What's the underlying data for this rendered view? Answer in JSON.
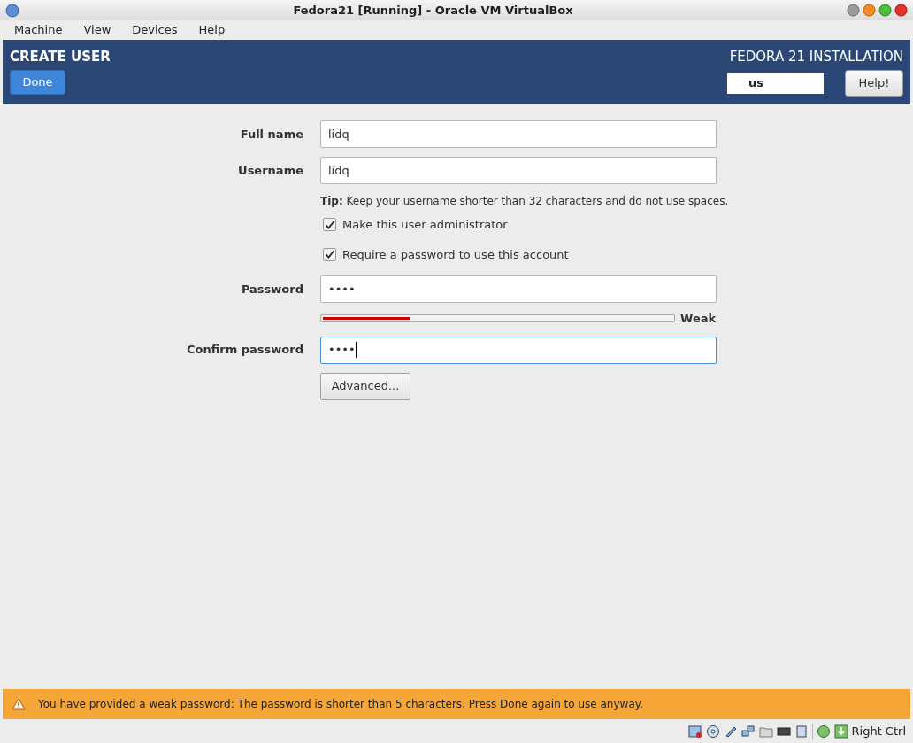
{
  "window": {
    "title": "Fedora21 [Running] - Oracle VM VirtualBox"
  },
  "menu": [
    "Machine",
    "View",
    "Devices",
    "Help"
  ],
  "header": {
    "title": "CREATE USER",
    "done": "Done",
    "product": "FEDORA 21 INSTALLATION",
    "keyboard": "us",
    "help": "Help!"
  },
  "form": {
    "fields": [
      {
        "kind": "text",
        "label": "Full name",
        "value": "lidq",
        "focused": false
      },
      {
        "kind": "text",
        "label": "Username",
        "value": "lidq",
        "focused": false
      },
      {
        "kind": "tip",
        "text": "**Tip:** Keep your username shorter than 32 characters and do not use spaces."
      },
      {
        "kind": "checkbox",
        "label": "Make this user administrator",
        "checked": true
      },
      {
        "kind": "checkbox",
        "label": "Require a password to use this account",
        "checked": true
      },
      {
        "kind": "text",
        "label": "Password",
        "value": "••••",
        "focused": false
      },
      {
        "kind": "meter",
        "level": 0.25,
        "reading": "Weak"
      },
      {
        "kind": "text",
        "label": "Confirm password",
        "value": "••••",
        "focused": true
      },
      {
        "kind": "button",
        "label": "Advanced..."
      }
    ]
  },
  "warning": "You have provided a weak password: The password is shorter than 5 characters. Press Done again to use anyway.",
  "status_bar": {
    "host_key": "Right Ctrl"
  }
}
